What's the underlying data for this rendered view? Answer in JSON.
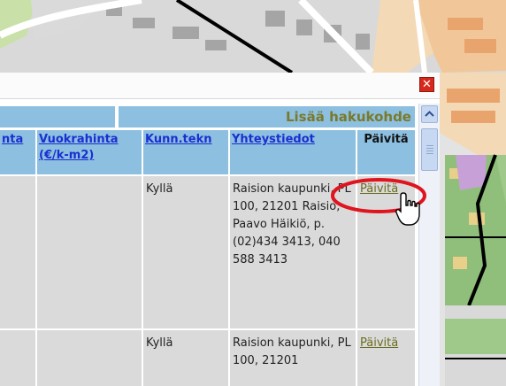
{
  "window": {
    "close_symbol": "✕"
  },
  "search": {
    "add_label": "Lisää hakukohde"
  },
  "table": {
    "headers": [
      {
        "label": "nta"
      },
      {
        "label": "Vuokrahinta (€/k-m2)"
      },
      {
        "label": "Kunn.tekn"
      },
      {
        "label": "Yhteystiedot"
      },
      {
        "label": "Päivitä"
      }
    ],
    "rows": [
      {
        "kunnallistekniikka": "Kyllä",
        "yhteystiedot": "Raision kaupunki, PL 100, 21201 Raisio, Paavo Häikiö, p.(02)434 3413, 040 588 3413",
        "update_label": "Päivitä"
      },
      {
        "kunnallistekniikka": "Kyllä",
        "yhteystiedot": "Raision kaupunki, PL 100, 21201",
        "update_label": "Päivitä"
      }
    ]
  },
  "colors": {
    "header_blue": "#8cbfe0",
    "link_blue": "#1a2fd0",
    "link_olive": "#6c6c22",
    "highlight_red": "#e0141e",
    "cell_gray": "#dadada"
  },
  "icons": {
    "close": "close-icon",
    "scroll_up": "chevron-up-icon",
    "cursor": "hand-cursor-icon"
  }
}
